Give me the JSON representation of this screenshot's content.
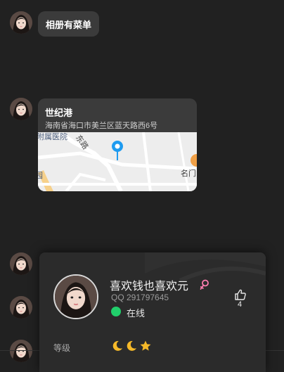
{
  "messages": [
    {
      "type": "text",
      "text": "相册有菜单"
    },
    {
      "type": "location",
      "title": "世纪港",
      "address": "海南省海口市美兰区蓝天路西6号",
      "map_labels": {
        "hospital": "附属医院",
        "road": "东路",
        "left_edge": "园",
        "right_edge": "名门"
      }
    }
  ],
  "profile_card": {
    "name": "喜欢钱也喜欢元",
    "gender_icon": "female-icon",
    "qq": "QQ 291797645",
    "status": "在线",
    "status_color": "#21cf6b",
    "likes": "4",
    "level_label": "等级",
    "level_icons": [
      "moon-icon",
      "moon-icon",
      "star-icon"
    ]
  },
  "colors": {
    "background": "#212121",
    "bubble": "#3b3b3b",
    "card": "#2b2b2b",
    "map_pin": "#1e9bf0",
    "female": "#ff7eb0",
    "level_gold": "#f5b929"
  }
}
